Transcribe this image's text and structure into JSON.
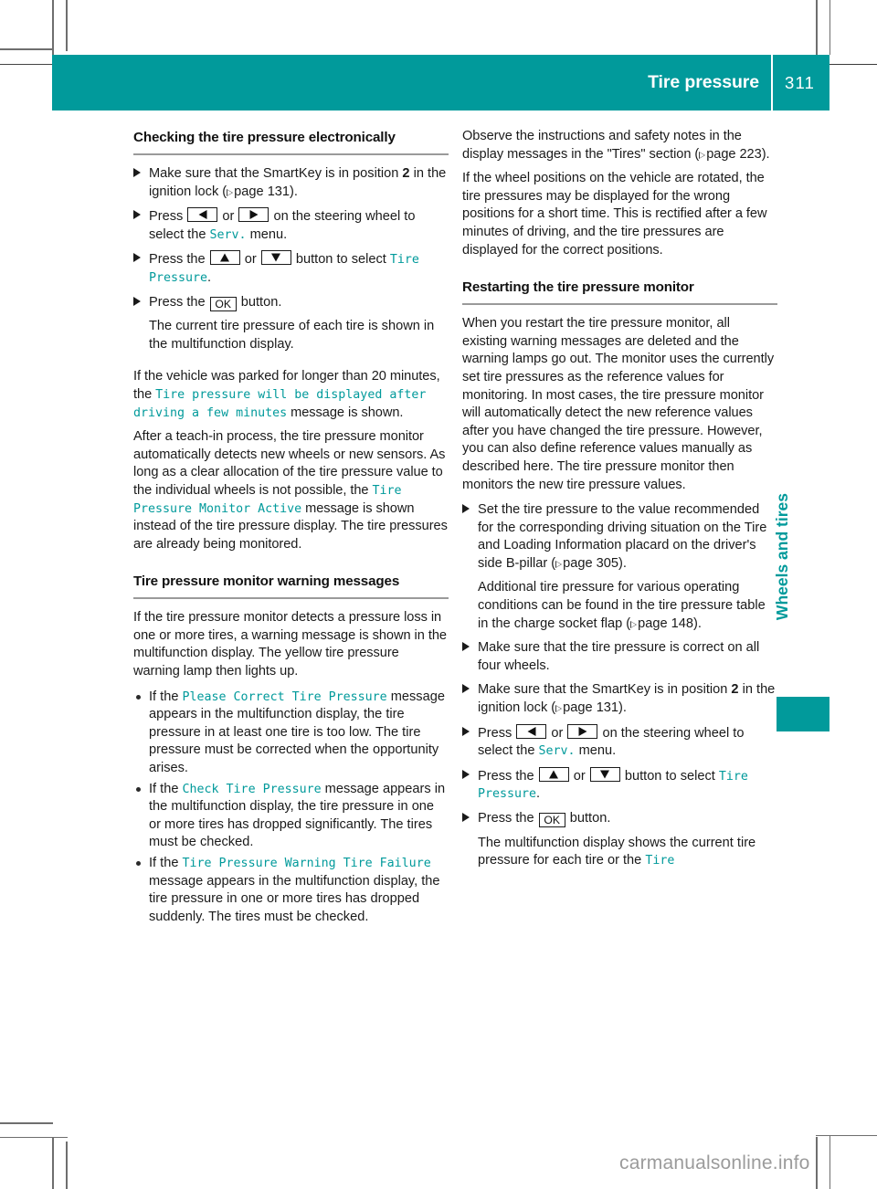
{
  "header": {
    "title": "Tire pressure",
    "page_number": "311"
  },
  "side_tab": {
    "label": "Wheels and tires"
  },
  "theme": {
    "accent": "#019a9b",
    "display_text": "#019a9b",
    "body_text": "#1a1a1a"
  },
  "left_column": {
    "heading": "Checking the tire pressure electronically",
    "steps": [
      {
        "t1": "Make sure that the SmartKey is in position ",
        "bold": "2",
        "t2": " in the ignition lock (",
        "ref": "page 131",
        "t3": ")."
      },
      {
        "t1": "Press ",
        "key1": "left-arrow",
        "t2": " or ",
        "key2": "right-arrow",
        "t3": " on the steering wheel to select the ",
        "disp": "Serv.",
        "t4": " menu."
      },
      {
        "t1": "Press the ",
        "key1": "up-arrow",
        "t2": " or ",
        "key2": "down-arrow",
        "t3": " button to select ",
        "disp": "Tire Pressure",
        "t4": "."
      },
      {
        "t1": "Press the ",
        "key1": "OK",
        "t2": " button.",
        "sub": "The current tire pressure of each tire is shown in the multifunction display."
      }
    ],
    "para_parked": {
      "t1": "If the vehicle was parked for longer than 20 minutes, the ",
      "disp": "Tire pressure will be displayed after driving a few minutes",
      "t2": " message is shown."
    },
    "para_teachin": {
      "t1": "After a teach-in process, the tire pressure monitor automatically detects new wheels or new sensors. As long as a clear allocation of the tire pressure value to the individual wheels is not possible, the ",
      "disp": "Tire Pressure Monitor Active",
      "t2": " message is shown instead of the tire pressure display. The tire pressures are already being monitored."
    },
    "heading2": "Tire pressure monitor warning messages",
    "para_warning": "If the tire pressure monitor detects a pressure loss in one or more tires, a warning message is shown in the multifunction display. The yellow tire pressure warning lamp then lights up.",
    "bullets": [
      {
        "t1": "If the ",
        "disp": "Please Correct Tire Pressure",
        "t2": " message appears in the multifunction display, the tire pressure in at least one tire is too low. The tire pressure must be corrected when the opportunity arises."
      },
      {
        "t1": "If the ",
        "disp": "Check Tire Pressure",
        "t2": " message appears in the multifunction display, the tire pressure in one or more tires has dropped significantly. The tires must be checked."
      },
      {
        "t1": "If the ",
        "disp": "Tire Pressure Warning Tire Failure",
        "t2": " message appears in the multifunction display, the tire pressure in one or more tires has dropped suddenly. The tires must be checked."
      }
    ]
  },
  "right_column": {
    "para_observe": {
      "t1": "Observe the instructions and safety notes in the display messages in the \"Tires\" section (",
      "ref": "page 223",
      "t2": ")."
    },
    "para_rotated": "If the wheel positions on the vehicle are rotated, the tire pressures may be displayed for the wrong positions for a short time. This is rectified after a few minutes of driving, and the tire pressures are displayed for the correct positions.",
    "heading": "Restarting the tire pressure monitor",
    "para_restart": "When you restart the tire pressure monitor, all existing warning messages are deleted and the warning lamps go out. The monitor uses the currently set tire pressures as the reference values for monitoring. In most cases, the tire pressure monitor will automatically detect the new reference values after you have changed the tire pressure. However, you can also define reference values manually as described here. The tire pressure monitor then monitors the new tire pressure values.",
    "steps": [
      {
        "t1": "Set the tire pressure to the value recommended for the corresponding driving situation on the Tire and Loading Information placard on the driver's side B-pillar (",
        "ref": "page 305",
        "t2": ").",
        "sub_t1": "Additional tire pressure for various operating conditions can be found in the tire pressure table in the charge socket flap (",
        "sub_ref": "page 148",
        "sub_t2": ")."
      },
      {
        "t1": "Make sure that the tire pressure is correct on all four wheels."
      },
      {
        "t1": "Make sure that the SmartKey is in position ",
        "bold": "2",
        "t2": " in the ignition lock (",
        "ref": "page 131",
        "t3": ")."
      },
      {
        "t1": "Press ",
        "key1": "left-arrow",
        "t2": " or ",
        "key2": "right-arrow",
        "t3": " on the steering wheel to select the ",
        "disp": "Serv.",
        "t4": " menu."
      },
      {
        "t1": "Press the ",
        "key1": "up-arrow",
        "t2": " or ",
        "key2": "down-arrow",
        "t3": " button to select ",
        "disp": "Tire Pressure",
        "t4": "."
      },
      {
        "t1": "Press the ",
        "key1": "OK",
        "t2": " button.",
        "sub_t1": "The multifunction display shows the current tire pressure for each tire or the ",
        "sub_disp": "Tire"
      }
    ]
  },
  "watermark": "carmanualsonline.info",
  "keys": {
    "ok_label": "OK"
  }
}
